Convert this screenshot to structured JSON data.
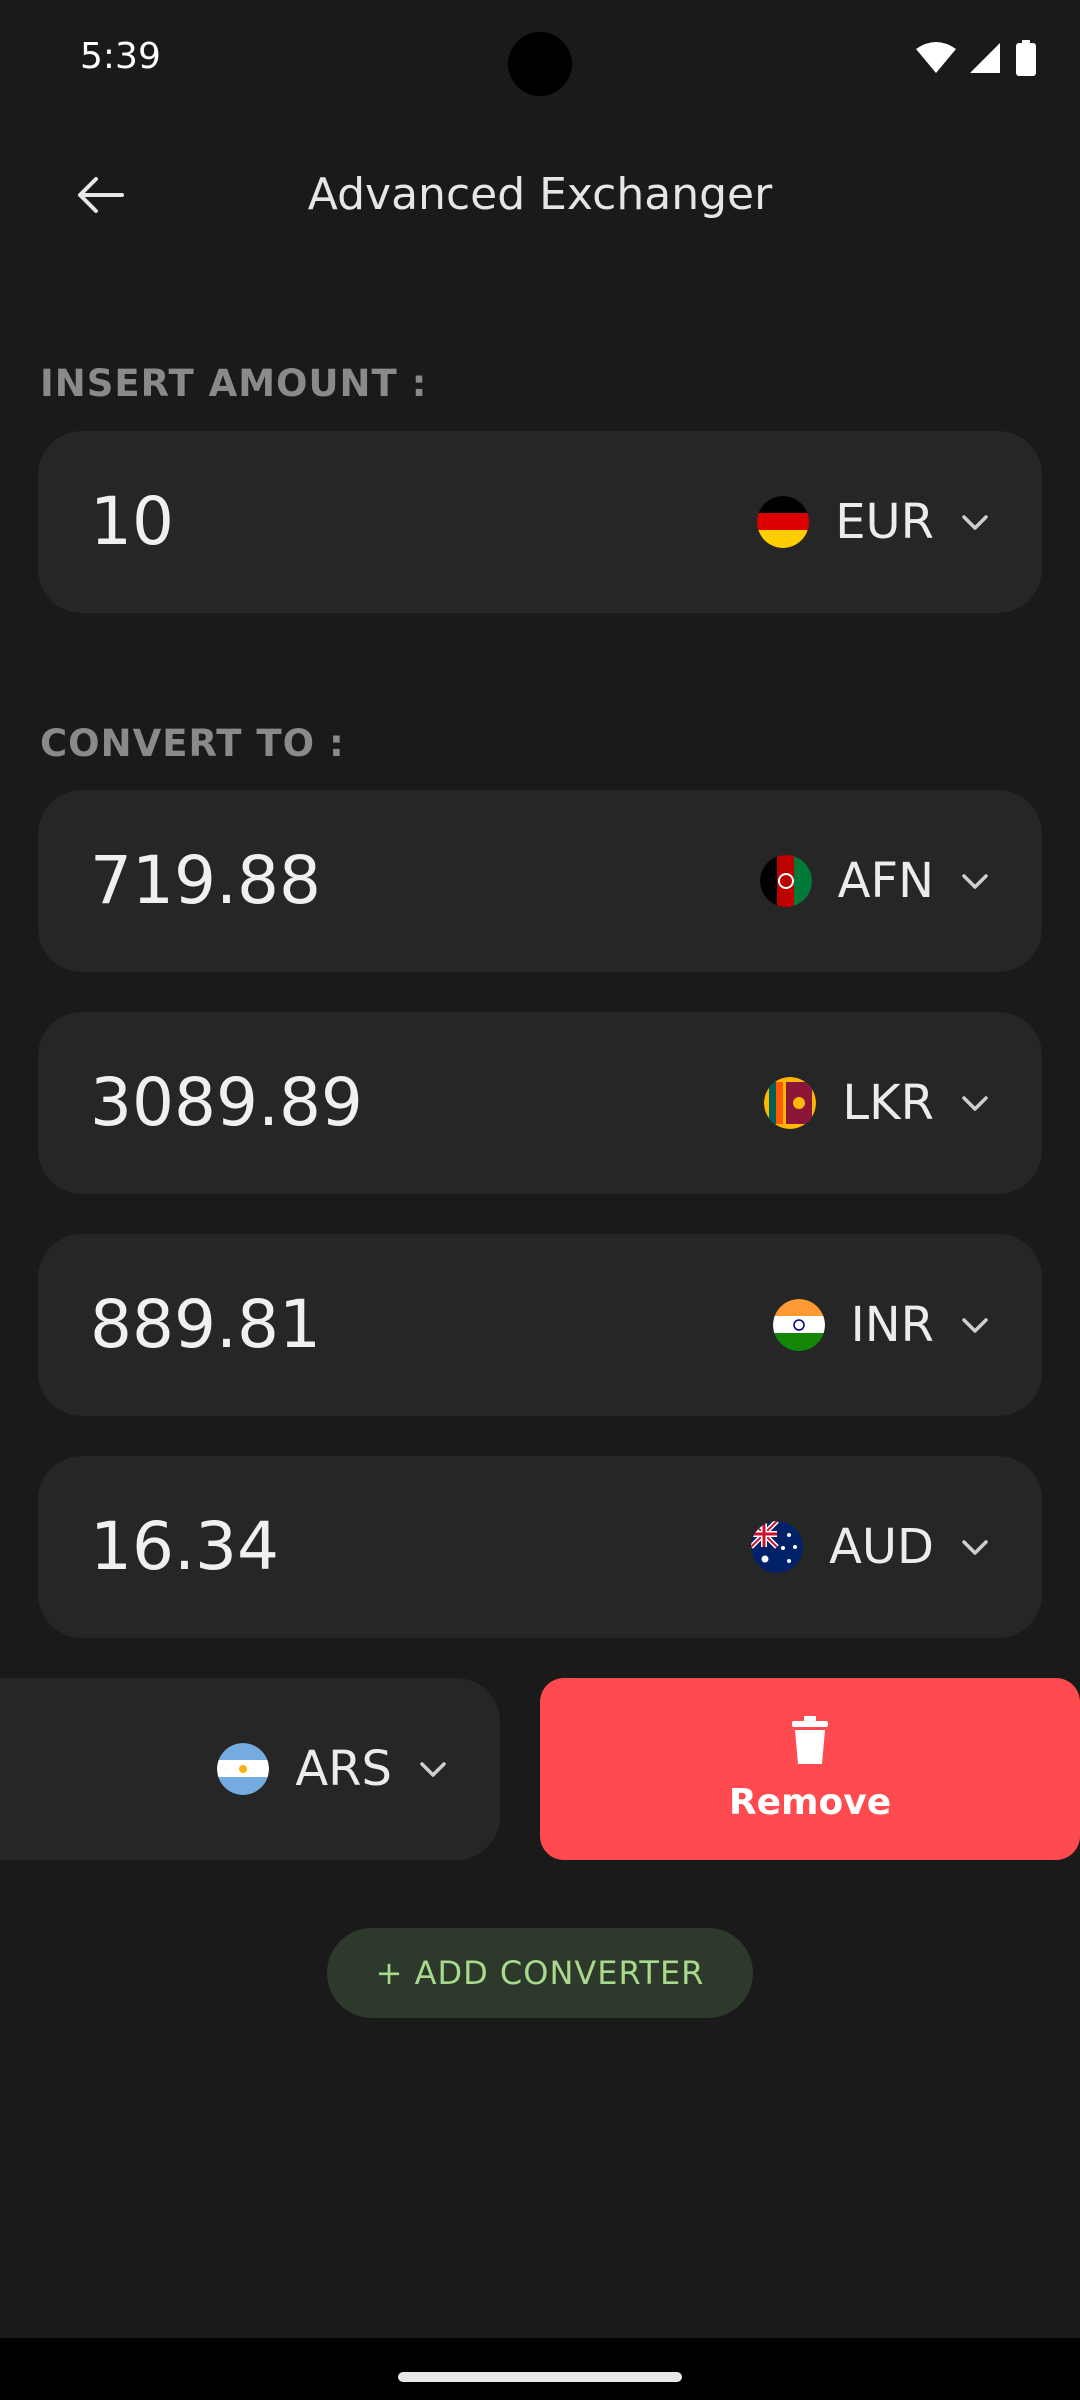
{
  "status_bar": {
    "time": "5:39"
  },
  "app_bar": {
    "title": "Advanced Exchanger"
  },
  "amount_section": {
    "label": "INSERT AMOUNT :",
    "value": "10",
    "currency": "EUR"
  },
  "convert_section": {
    "label": "CONVERT TO :",
    "rows": [
      {
        "value": "719.88",
        "currency": "AFN"
      },
      {
        "value": "3089.89",
        "currency": "LKR"
      },
      {
        "value": "889.81",
        "currency": "INR"
      },
      {
        "value": "16.34",
        "currency": "AUD"
      }
    ],
    "swiped_row": {
      "currency": "ARS"
    }
  },
  "remove_action": {
    "label": "Remove"
  },
  "add_converter": {
    "label": "+ ADD CONVERTER"
  },
  "colors": {
    "background": "#1a1a1a",
    "card": "#272627",
    "remove": "#ff4b4f",
    "add_button_bg": "#2d3a2b",
    "add_button_text": "#a9d98c"
  }
}
